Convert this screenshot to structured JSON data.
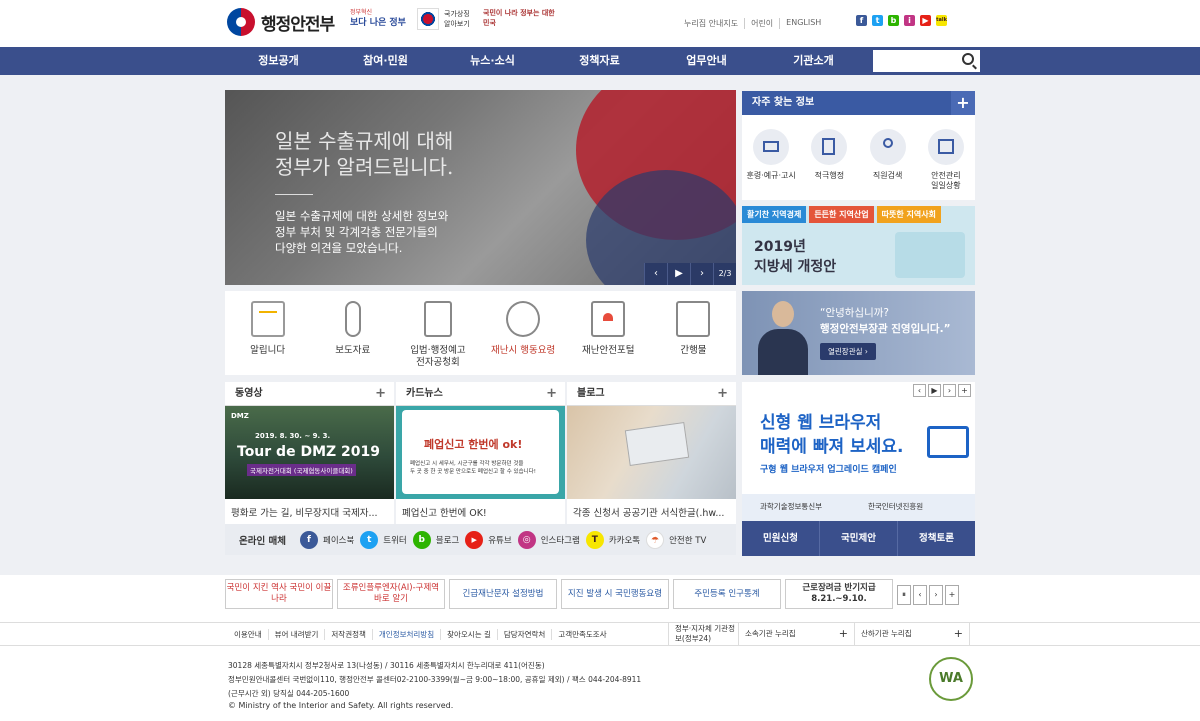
{
  "header": {
    "logo_text": "행정안전부",
    "banner1_small": "정부혁신",
    "banner1_main": "보다 나은 정부",
    "banner2": "국가상징 알아보기",
    "banner3": "국민이 나라 정부는 대한민국",
    "util_links": [
      "누리집 안내지도",
      "어린이",
      "ENGLISH"
    ],
    "sns": [
      "f",
      "t",
      "b",
      "i",
      "▶",
      "talk"
    ]
  },
  "gnb": {
    "items": [
      "정보공개",
      "참여·민원",
      "뉴스·소식",
      "정책자료",
      "업무안내",
      "기관소개"
    ],
    "search_placeholder": ""
  },
  "hero": {
    "title_line1": "일본 수출규제에 대해",
    "title_line2": "정부가 알려드립니다.",
    "desc_line1": "일본 수출규제에 대한 상세한 정보와",
    "desc_line2": "정부 부처 및 각계각층 전문가들의",
    "desc_line3": "다양한 의견을 모았습니다.",
    "prev": "‹",
    "play": "▶",
    "next": "›",
    "pager": "2/3"
  },
  "quick": [
    {
      "label1": "알립니다",
      "label2": ""
    },
    {
      "label1": "보도자료",
      "label2": ""
    },
    {
      "label1": "입법·행정예고",
      "label2": "전자공청회"
    },
    {
      "label1": "재난시 행동요령",
      "label2": ""
    },
    {
      "label1": "재난안전포털",
      "label2": ""
    },
    {
      "label1": "간행물",
      "label2": ""
    }
  ],
  "tri": [
    {
      "title": "동영상",
      "caption": "평화로 가는 길, 비무장지대 국제자...",
      "img_line1": "2019. 8. 30. ~ 9. 3.",
      "img_line2": "Tour de DMZ 2019",
      "img_line3": "국제자전거대회 (국제협동사이클대회)",
      "img_corner": "DMZ"
    },
    {
      "title": "카드뉴스",
      "caption": "폐업신고 한번에 OK!",
      "img_line1": "폐업신고 한번에 ok!",
      "img_line2": "폐업신고 시 세무서, 시군구를 각각 방문하던 것을",
      "img_line3": "두 곳 중 한 곳 방문 만으로도 폐업신고 할 수 있습니다!"
    },
    {
      "title": "블로그",
      "caption": "각종 신청서 공공기관 서식한글(.hw..."
    }
  ],
  "media": {
    "title": "온라인 매체",
    "items": [
      {
        "icon": "f",
        "label": "페이스북",
        "color": "#3b5998"
      },
      {
        "icon": "t",
        "label": "트위터",
        "color": "#1da1f2"
      },
      {
        "icon": "b",
        "label": "블로그",
        "color": "#2db400"
      },
      {
        "icon": "▶",
        "label": "유튜브",
        "color": "#e62117"
      },
      {
        "icon": "◎",
        "label": "인스타그램",
        "color": "#c13584"
      },
      {
        "icon": "T",
        "label": "카카오톡",
        "color": "#3c1e1e"
      },
      {
        "icon": "☂",
        "label": "안전한 TV",
        "color": "#e05a2a"
      }
    ]
  },
  "fav": {
    "title": "자주 찾는 정보",
    "plus": "+",
    "items": [
      {
        "label1": "훈령·예규·고시",
        "label2": ""
      },
      {
        "label1": "적극행정",
        "label2": ""
      },
      {
        "label1": "직원검색",
        "label2": ""
      },
      {
        "label1": "안전관리",
        "label2": "일일상황"
      }
    ]
  },
  "bn1": {
    "tags": [
      "활기찬 지역경제",
      "든든한 지역산업",
      "따뜻한 지역사회"
    ],
    "line1": "2019년",
    "line2": "지방세 개정안"
  },
  "bn2": {
    "line1": "“안녕하십니까?",
    "line2": "행정안전부장관 진영입니다.”",
    "btn": "열린장관실 ›"
  },
  "bn3": {
    "ctl": [
      "‹",
      "▶",
      "›",
      "+"
    ],
    "line1": "신형 웹 브라우저",
    "line2": "매력에 빠져 보세요.",
    "line3": "구형 웹 브라우저 업그레이드 캠페인",
    "org1": "과학기술정보통신부",
    "org2": "한국인터넷진흥원"
  },
  "svc": [
    "민원신청",
    "국민제안",
    "정책토론"
  ],
  "banners": [
    {
      "text": "국민이 지킨 역사 국민이 이끌 나라",
      "w": 108
    },
    {
      "text": "조류인플루엔자(AI)-구제역 바로 알기",
      "w": 108
    },
    {
      "text": "긴급재난문자 설정방법",
      "w": 108
    },
    {
      "text": "지진 발생 시 국민행동요령",
      "w": 108
    },
    {
      "text": "주민등록 인구통계",
      "w": 108
    },
    {
      "text": "근로장려금 반기지급 8.21.~9.10.",
      "w": 108
    }
  ],
  "banner_ctl": [
    "⏸",
    "‹",
    "›",
    "+"
  ],
  "footer": {
    "links": [
      "이용안내",
      "뷰어 내려받기",
      "저작권정책",
      "개인정보처리방침",
      "찾아오시는 길",
      "담당자연락처",
      "고객만족도조사"
    ],
    "sel1": "정부·지자체 기관정보(정부24)",
    "sel2": "소속기관 누리집",
    "sel3": "산하기관 누리집",
    "addr1": "30128 세종특별자치시 정부2청사로 13(나성동) / 30116 세종특별자치시 한누리대로 411(어진동)",
    "addr2": "정부민원안내콜센터 국번없이110, 행정안전부 콜센터02-2100-3399(월~금 9:00~18:00, 공휴일 제외) / 팩스 044-204-8911",
    "addr3": "(근무시간 외) 당직실 044-205-1600",
    "copyright": "© Ministry of the Interior and Safety. All rights reserved.",
    "wa": "WA"
  }
}
